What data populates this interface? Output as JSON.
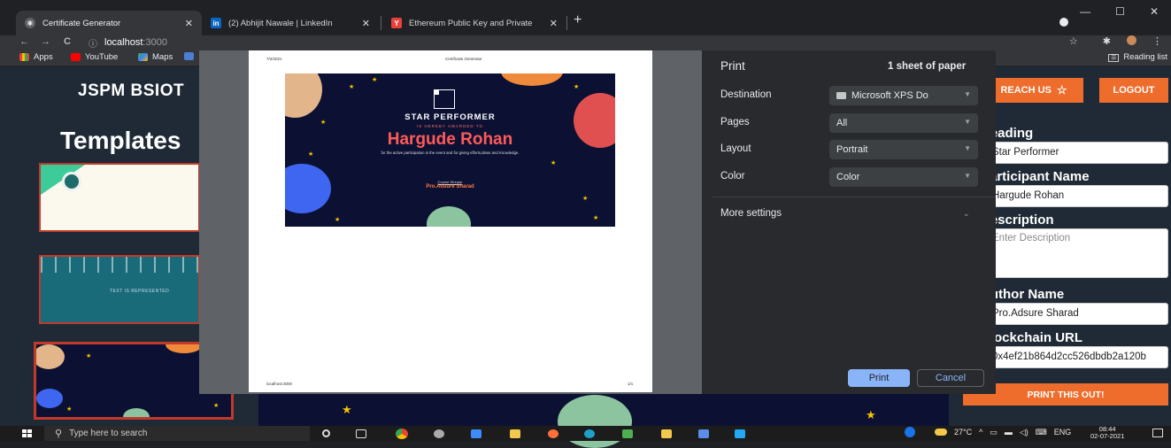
{
  "browser": {
    "tabs": [
      {
        "title": "Certificate Generator",
        "active": true
      },
      {
        "title": "(2) Abhijit Nawale | LinkedIn",
        "active": false
      },
      {
        "title": "Ethereum Public Key and Private",
        "active": false
      }
    ],
    "new_tab": "+",
    "close_glyph": "✕",
    "url_host": "localhost",
    "url_port": ":3000",
    "bookmarks": [
      "Apps",
      "YouTube",
      "Maps"
    ],
    "reading_list": "Reading list",
    "window_controls": [
      "—",
      "☐",
      "✕"
    ],
    "colors": {
      "linkedin": "#0a66c2",
      "ethereum": "#e8413b",
      "chrome_tab": "#35363a"
    }
  },
  "app": {
    "brand": "JSPM BSIOT",
    "templates_title": "Templates",
    "reach_us": "REACH US",
    "logout": "LOGOUT",
    "accent": "#ee6c2c",
    "form": {
      "heading_label": "Heading",
      "heading_value": "Star Performer",
      "participant_label": "Participant Name",
      "participant_value": "Hargude Rohan",
      "description_label": "Description",
      "description_placeholder": "Enter Description",
      "author_label": "Author Name",
      "author_value": "Pro.Adsure Sharad",
      "blockchain_label": "Blockchain URL",
      "blockchain_value": "0x4ef21b864d2cc526dbdb2a120b"
    },
    "print_button": "PRINT THIS OUT!",
    "template2_caption": "TEXT IS REPRESENTED"
  },
  "print_dialog": {
    "title": "Print",
    "sheets": "1 sheet of paper",
    "destination_label": "Destination",
    "destination_value": "Microsoft XPS Do",
    "pages_label": "Pages",
    "pages_value": "All",
    "layout_label": "Layout",
    "layout_value": "Portrait",
    "color_label": "Color",
    "color_value": "Color",
    "more_settings": "More settings",
    "print": "Print",
    "cancel": "Cancel",
    "accent": "#8ab4f8"
  },
  "preview": {
    "date": "7/2/2021",
    "page_title": "Certificate Generator",
    "footer_url": "localhost:3000",
    "page_number": "1/1",
    "certificate": {
      "heading": "STAR PERFORMER",
      "subheading": "IS HEREBY AWARDED TO",
      "name": "Hargude Rohan",
      "description": "for the active participation in the event and for giving efforts,ideas and Knowledge.",
      "role": "Course Director",
      "author": "Pro.Adsure Sharad"
    }
  },
  "taskbar": {
    "search_placeholder": "Type here to search",
    "temperature": "27°C",
    "language": "ENG",
    "time": "08:44",
    "date": "02-07-2021"
  }
}
